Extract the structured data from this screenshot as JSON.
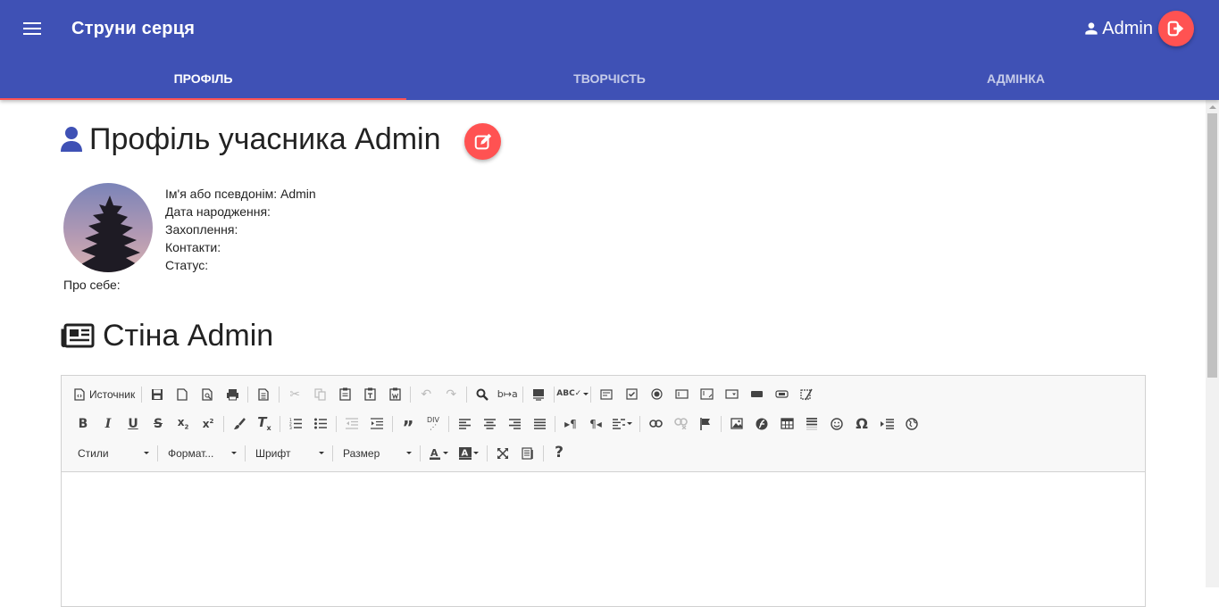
{
  "app": {
    "title": "Струни серця"
  },
  "user": {
    "name": "Admin"
  },
  "tabs": [
    {
      "label": "ПРОФІЛЬ",
      "active": true
    },
    {
      "label": "ТВОРЧІСТЬ",
      "active": false
    },
    {
      "label": "АДМІНКА",
      "active": false
    }
  ],
  "profile": {
    "title": "Профіль учасника Admin",
    "fields": [
      "Ім'я або псевдонім: Admin",
      "Дата народження:",
      "Захоплення:",
      "Контакти:",
      "Статус:"
    ],
    "about_label": "Про себе:"
  },
  "wall": {
    "title": "Стіна Admin"
  },
  "editor": {
    "source_label": "Источник",
    "combos": {
      "styles": "Стили",
      "format": "Формат...",
      "font": "Шрифт",
      "size": "Размер"
    }
  },
  "colors": {
    "primary": "#3f51b5",
    "accent": "#ff5252"
  }
}
